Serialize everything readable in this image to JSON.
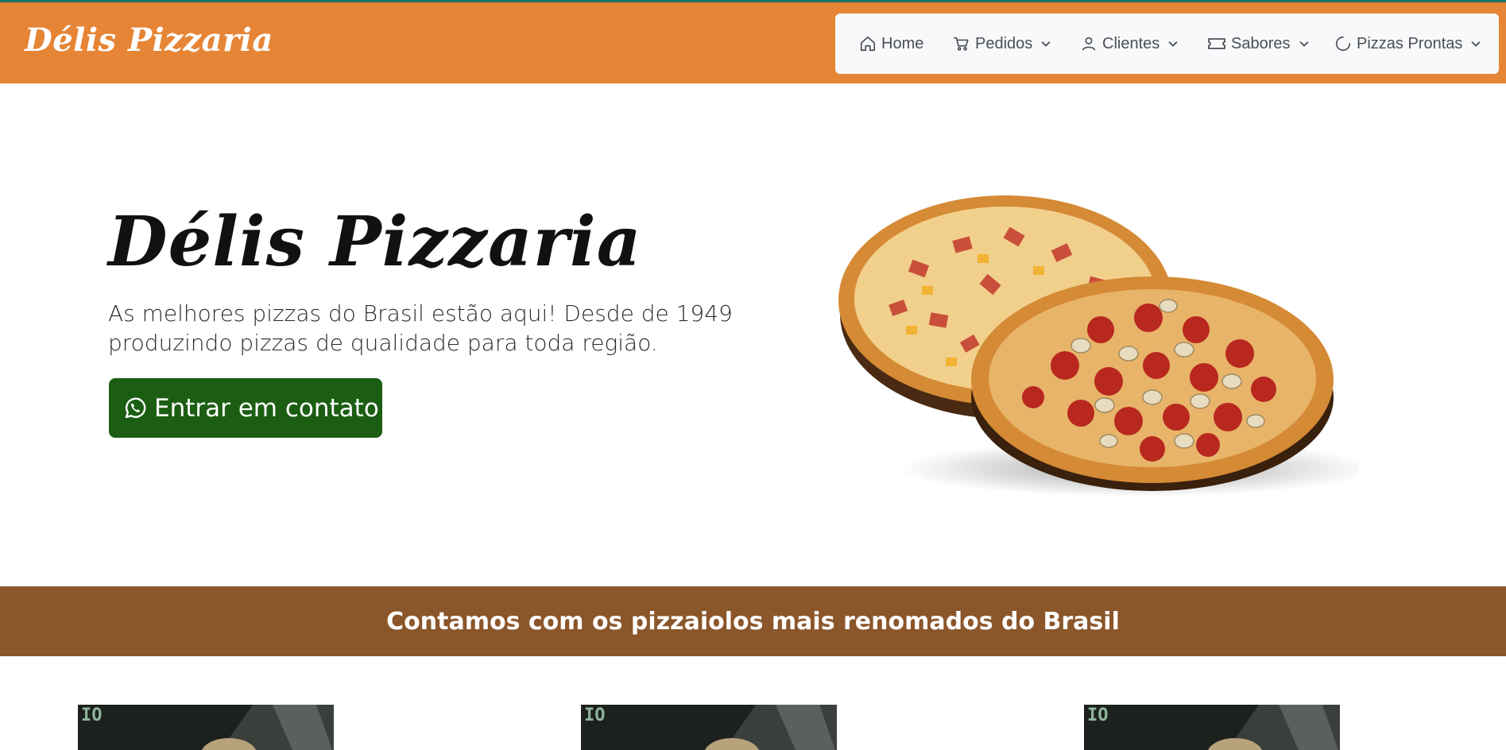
{
  "header": {
    "brand": "Délis Pizzaria",
    "nav": [
      {
        "label": "Home",
        "icon": "home-icon"
      },
      {
        "label": "Pedidos",
        "icon": "cart-icon"
      },
      {
        "label": "Clientes",
        "icon": "user-icon"
      },
      {
        "label": "Sabores",
        "icon": "ticket-icon"
      },
      {
        "label": "Pizzas Prontas",
        "icon": "spinner-icon"
      }
    ]
  },
  "hero": {
    "title": "Délis Pizzaria",
    "text": "As melhores pizzas do Brasil estão aqui! Desde de 1949 produzindo pizzas de qualidade para toda região.",
    "cta_label": "Entrar em contato",
    "cta_icon": "whatsapp-icon"
  },
  "band": {
    "text": "Contamos com os pizzaiolos mais renomados do Brasil"
  },
  "colors": {
    "header_bg": "#e68535",
    "cta_bg": "#1b5e13",
    "band_bg": "#8b562a"
  }
}
